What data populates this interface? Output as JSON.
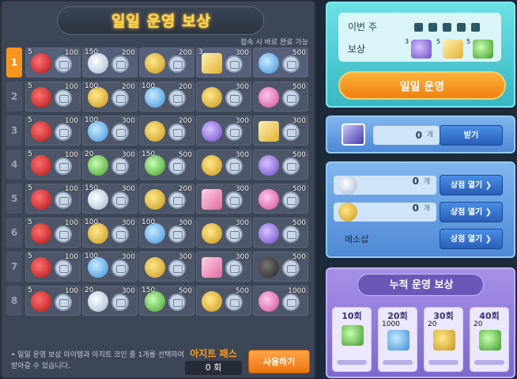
{
  "left": {
    "title": "일일 운영 보상",
    "subtitle": "접속 시 바로 완료 가능",
    "rows": [
      {
        "num": "1",
        "active": true,
        "cells": [
          {
            "qty": "5",
            "icon": "red",
            "coin": "100"
          },
          {
            "qty": "150",
            "icon": "white",
            "coin": "200"
          },
          {
            "qty": "",
            "icon": "gold",
            "coin": "200"
          },
          {
            "qty": "3",
            "icon": "ticket",
            "coin": "300"
          },
          {
            "qty": "",
            "icon": "blue",
            "coin": "500"
          }
        ]
      },
      {
        "num": "2",
        "active": false,
        "cells": [
          {
            "qty": "5",
            "icon": "red",
            "coin": "100"
          },
          {
            "qty": "100",
            "icon": "gold",
            "coin": "200"
          },
          {
            "qty": "100",
            "icon": "blue",
            "coin": "200"
          },
          {
            "qty": "",
            "icon": "gold",
            "coin": "300"
          },
          {
            "qty": "",
            "icon": "pink",
            "coin": "500"
          }
        ]
      },
      {
        "num": "3",
        "active": false,
        "cells": [
          {
            "qty": "5",
            "icon": "red",
            "coin": "100"
          },
          {
            "qty": "100",
            "icon": "blue",
            "coin": "300"
          },
          {
            "qty": "",
            "icon": "gold",
            "coin": "200"
          },
          {
            "qty": "",
            "icon": "purple",
            "coin": "300"
          },
          {
            "qty": "",
            "icon": "ticket",
            "coin": "300"
          }
        ]
      },
      {
        "num": "4",
        "active": false,
        "cells": [
          {
            "qty": "5",
            "icon": "red",
            "coin": "100"
          },
          {
            "qty": "20",
            "icon": "green",
            "coin": "300"
          },
          {
            "qty": "150",
            "icon": "green",
            "coin": "500"
          },
          {
            "qty": "",
            "icon": "gold",
            "coin": "300"
          },
          {
            "qty": "",
            "icon": "purple",
            "coin": "500"
          }
        ]
      },
      {
        "num": "5",
        "active": false,
        "cells": [
          {
            "qty": "5",
            "icon": "red",
            "coin": "100"
          },
          {
            "qty": "150",
            "icon": "white",
            "coin": "300"
          },
          {
            "qty": "",
            "icon": "gold",
            "coin": "200"
          },
          {
            "qty": "",
            "icon": "card",
            "coin": "300"
          },
          {
            "qty": "",
            "icon": "pink",
            "coin": "500"
          }
        ]
      },
      {
        "num": "6",
        "active": false,
        "cells": [
          {
            "qty": "5",
            "icon": "red",
            "coin": "100"
          },
          {
            "qty": "100",
            "icon": "gold",
            "coin": "300"
          },
          {
            "qty": "100",
            "icon": "blue",
            "coin": "300"
          },
          {
            "qty": "",
            "icon": "gold",
            "coin": "300"
          },
          {
            "qty": "",
            "icon": "purple",
            "coin": "500"
          }
        ]
      },
      {
        "num": "7",
        "active": false,
        "cells": [
          {
            "qty": "5",
            "icon": "red",
            "coin": "100"
          },
          {
            "qty": "100",
            "icon": "blue",
            "coin": "300"
          },
          {
            "qty": "",
            "icon": "gold",
            "coin": "300"
          },
          {
            "qty": "",
            "icon": "card",
            "coin": "300"
          },
          {
            "qty": "",
            "icon": "dark",
            "coin": "500"
          }
        ]
      },
      {
        "num": "8",
        "active": false,
        "cells": [
          {
            "qty": "5",
            "icon": "red",
            "coin": "100"
          },
          {
            "qty": "20",
            "icon": "white",
            "coin": "300"
          },
          {
            "qty": "150",
            "icon": "green",
            "coin": "500"
          },
          {
            "qty": "",
            "icon": "gold",
            "coin": "500"
          },
          {
            "qty": "",
            "icon": "pink",
            "coin": "1000"
          }
        ]
      }
    ],
    "footer_note": "• 일일 운영 보상 아이템과 아지트 코인 중 1개를 선택하여 받아갈 수 있습니다.",
    "pass_label": "아지트 패스",
    "pass_count": "0 회",
    "use_button": "사용하기"
  },
  "weekly": {
    "week_label": "이번 주",
    "reward_label": "보상",
    "reward_icons": [
      {
        "qty": "3",
        "icon": "purple"
      },
      {
        "qty": "5",
        "icon": "ticket"
      },
      {
        "qty": "5",
        "icon": "green"
      }
    ],
    "daily_button": "일일 운영"
  },
  "claim": {
    "count": "0",
    "unit": "개",
    "button": "받기"
  },
  "shop": {
    "rows": [
      {
        "icon": "silver",
        "count": "0",
        "unit": "개",
        "button": "상점 열기 ❯"
      },
      {
        "icon": "gold",
        "count": "0",
        "unit": "개",
        "button": "상점 열기 ❯"
      }
    ],
    "meso_label": "메소샵",
    "meso_button": "상점 열기 ❯"
  },
  "cumulative": {
    "title": "누적 운영 보상",
    "milestones": [
      {
        "label": "10회",
        "qty": "",
        "icon": "green"
      },
      {
        "label": "20회",
        "qty": "1000",
        "icon": "exp"
      },
      {
        "label": "30회",
        "qty": "20",
        "icon": "gold"
      },
      {
        "label": "40회",
        "qty": "20",
        "icon": "green"
      }
    ]
  }
}
